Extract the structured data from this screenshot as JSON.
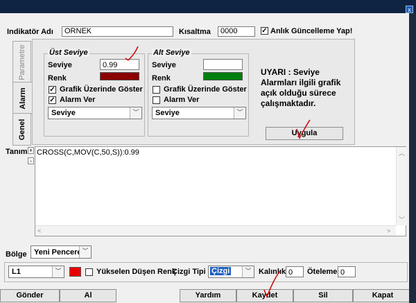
{
  "window": {
    "close_glyph": "x"
  },
  "header": {
    "name_label": "Indikatör Adı",
    "name_value": "ORNEK",
    "short_label": "Kısaltma",
    "short_value": "0000",
    "live_update_label": "Anlık Güncelleme Yap!",
    "live_update_checked": true
  },
  "tabs": [
    {
      "label": "Parametre",
      "active": false
    },
    {
      "label": "Alarm",
      "active": true
    },
    {
      "label": "Genel",
      "active": false
    }
  ],
  "upper_level": {
    "title": "Üst Seviye",
    "level_label": "Seviye",
    "level_value": "0.99",
    "color_label": "Renk",
    "color": "#8b0000",
    "show_on_chart_label": "Grafik Üzerinde Göster",
    "show_on_chart_checked": true,
    "alarm_label": "Alarm Ver",
    "alarm_checked": true,
    "type_value": "Seviye"
  },
  "lower_level": {
    "title": "Alt Seviye",
    "level_label": "Seviye",
    "level_value": "",
    "color_label": "Renk",
    "color": "#00800d",
    "show_on_chart_label": "Grafik Üzerinde Göster",
    "show_on_chart_checked": false,
    "alarm_label": "Alarm Ver",
    "alarm_checked": false,
    "type_value": "Seviye"
  },
  "warning_text": "UYARI : Seviye Alarmları ilgili grafik açık olduğu sürece çalışmaktadır.",
  "apply_button": "Uygula",
  "definition": {
    "label": "Tanım",
    "plus": "+",
    "minus": "-",
    "formula": "CROSS(C,MOV(C,50,S)):0.99"
  },
  "region": {
    "label": "Bölge",
    "value": "Yeni Pencere"
  },
  "line": {
    "series_value": "L1",
    "color": "#e80000",
    "rise_fall_label": "Yükselen Düşen Renk",
    "line_type_label": "Çizgi Tipi",
    "line_type_value": "Çizgi",
    "thickness_label": "Kalınlık",
    "thickness_value": "0",
    "offset_label": "Öteleme",
    "offset_value": "0"
  },
  "footer": {
    "send": "Gönder",
    "buy": "Al",
    "help": "Yardım",
    "save": "Kaydet",
    "delete": "Sil",
    "close": "Kapat"
  },
  "accent": {
    "selection": "#1f5fbf",
    "annotation": "#d01010"
  }
}
